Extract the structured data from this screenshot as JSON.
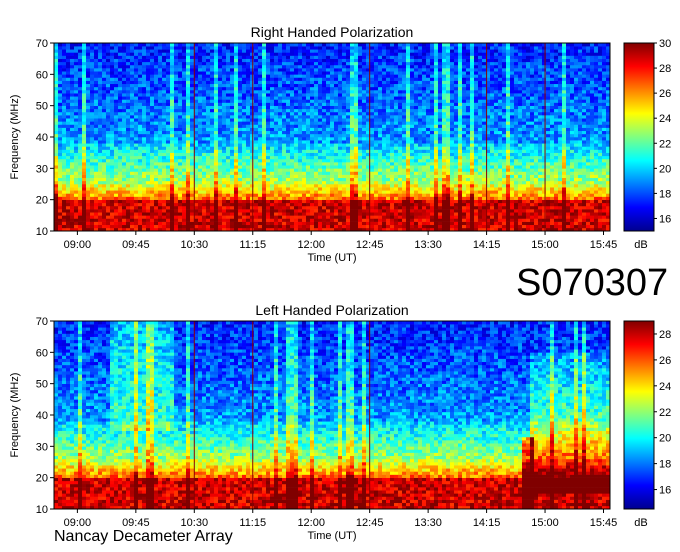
{
  "figure_id": "S070307",
  "footer_label": "Nancay Decameter Array",
  "colors": {
    "colormap": [
      "#00008f",
      "#0000ff",
      "#0080ff",
      "#00ffff",
      "#80ff80",
      "#ffff00",
      "#ff8000",
      "#ff0000",
      "#800000"
    ],
    "time_marker": "#8b0000"
  },
  "chart_data": [
    {
      "type": "heatmap",
      "title": "Right Handed Polarization",
      "xlabel": "Time (UT)",
      "ylabel": "Frequency (MHz)",
      "x_ticks": [
        "09:00",
        "09:45",
        "10:30",
        "11:15",
        "12:00",
        "12:45",
        "13:30",
        "14:15",
        "15:00",
        "15:45"
      ],
      "y_ticks": [
        10,
        20,
        30,
        40,
        50,
        60,
        70
      ],
      "ylim": [
        10,
        70
      ],
      "xlim": [
        "08:42",
        "15:50"
      ],
      "colorbar": {
        "label": "dB",
        "ticks": [
          16,
          18,
          20,
          22,
          24,
          26,
          28,
          30
        ],
        "range": [
          15,
          30
        ]
      },
      "vertical_markers_ut": [
        "10:30",
        "11:15",
        "12:45",
        "14:15",
        "15:00"
      ]
    },
    {
      "type": "heatmap",
      "title": "Left Handed Polarization",
      "xlabel": "Time (UT)",
      "ylabel": "Frequency (MHz)",
      "x_ticks": [
        "09:00",
        "09:45",
        "10:30",
        "11:15",
        "12:00",
        "12:45",
        "13:30",
        "14:15",
        "15:00",
        "15:45"
      ],
      "y_ticks": [
        10,
        20,
        30,
        40,
        50,
        60,
        70
      ],
      "ylim": [
        10,
        70
      ],
      "xlim": [
        "08:42",
        "15:50"
      ],
      "colorbar": {
        "label": "dB",
        "ticks": [
          16,
          18,
          20,
          22,
          24,
          26,
          28
        ],
        "range": [
          14.5,
          29
        ]
      },
      "vertical_markers_ut": [
        "10:30",
        "11:15",
        "12:45"
      ]
    }
  ]
}
